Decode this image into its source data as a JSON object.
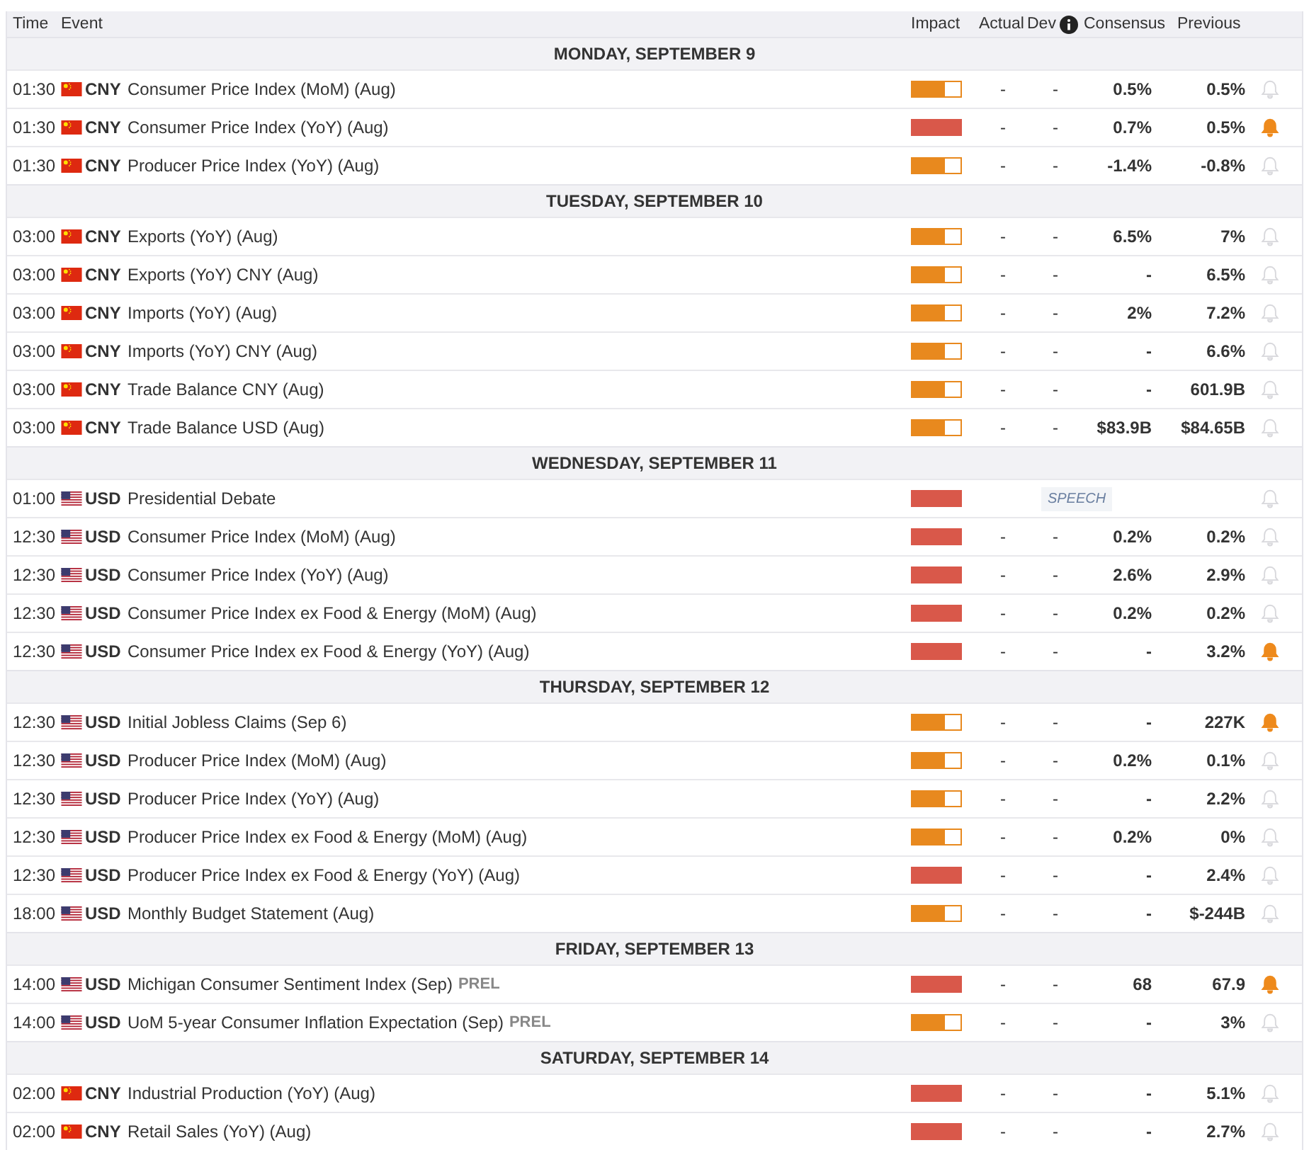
{
  "columns": [
    "Time",
    "Event",
    "Impact",
    "Actual",
    "Dev",
    "Consensus",
    "Previous"
  ],
  "days": [
    {
      "label": "MONDAY, SEPTEMBER 9",
      "events": [
        {
          "time": "01:30",
          "currency": "CNY",
          "event": "Consumer Price Index (MoM) (Aug)",
          "level": 0.66,
          "color": "#e8891e",
          "actual": "-",
          "dev": "-",
          "consensus": "0.5%",
          "previous": "0.5%",
          "alert": false
        },
        {
          "time": "01:30",
          "currency": "CNY",
          "event": "Consumer Price Index (YoY) (Aug)",
          "level": 1,
          "color": "#d9584a",
          "actual": "-",
          "dev": "-",
          "consensus": "0.7%",
          "previous": "0.5%",
          "alert": true
        },
        {
          "time": "01:30",
          "currency": "CNY",
          "event": "Producer Price Index (YoY) (Aug)",
          "level": 0.66,
          "color": "#e8891e",
          "actual": "-",
          "dev": "-",
          "consensus": "-1.4%",
          "previous": "-0.8%",
          "alert": false
        }
      ]
    },
    {
      "label": "TUESDAY, SEPTEMBER 10",
      "events": [
        {
          "time": "03:00",
          "currency": "CNY",
          "event": "Exports (YoY) (Aug)",
          "level": 0.66,
          "color": "#e8891e",
          "actual": "-",
          "dev": "-",
          "consensus": "6.5%",
          "previous": "7%",
          "alert": false
        },
        {
          "time": "03:00",
          "currency": "CNY",
          "event": "Exports (YoY) CNY (Aug)",
          "level": 0.66,
          "color": "#e8891e",
          "actual": "-",
          "dev": "-",
          "consensus": "-",
          "previous": "6.5%",
          "alert": false
        },
        {
          "time": "03:00",
          "currency": "CNY",
          "event": "Imports (YoY) (Aug)",
          "level": 0.66,
          "color": "#e8891e",
          "actual": "-",
          "dev": "-",
          "consensus": "2%",
          "previous": "7.2%",
          "alert": false
        },
        {
          "time": "03:00",
          "currency": "CNY",
          "event": "Imports (YoY) CNY (Aug)",
          "level": 0.66,
          "color": "#e8891e",
          "actual": "-",
          "dev": "-",
          "consensus": "-",
          "previous": "6.6%",
          "alert": false
        },
        {
          "time": "03:00",
          "currency": "CNY",
          "event": "Trade Balance CNY (Aug)",
          "level": 0.66,
          "color": "#e8891e",
          "actual": "-",
          "dev": "-",
          "consensus": "-",
          "previous": "601.9B",
          "alert": false
        },
        {
          "time": "03:00",
          "currency": "CNY",
          "event": "Trade Balance USD (Aug)",
          "level": 0.66,
          "color": "#e8891e",
          "actual": "-",
          "dev": "-",
          "consensus": "$83.9B",
          "previous": "$84.65B",
          "alert": false
        }
      ]
    },
    {
      "label": "WEDNESDAY, SEPTEMBER 11",
      "events": [
        {
          "time": "01:00",
          "currency": "USD",
          "event": "Presidential Debate",
          "level": 1,
          "color": "#d9584a",
          "tag": "SPEECH",
          "alert": false
        },
        {
          "time": "12:30",
          "currency": "USD",
          "event": "Consumer Price Index (MoM) (Aug)",
          "level": 1,
          "color": "#d9584a",
          "actual": "-",
          "dev": "-",
          "consensus": "0.2%",
          "previous": "0.2%",
          "alert": false
        },
        {
          "time": "12:30",
          "currency": "USD",
          "event": "Consumer Price Index (YoY) (Aug)",
          "level": 1,
          "color": "#d9584a",
          "actual": "-",
          "dev": "-",
          "consensus": "2.6%",
          "previous": "2.9%",
          "alert": false
        },
        {
          "time": "12:30",
          "currency": "USD",
          "event": "Consumer Price Index ex Food & Energy (MoM) (Aug)",
          "level": 1,
          "color": "#d9584a",
          "actual": "-",
          "dev": "-",
          "consensus": "0.2%",
          "previous": "0.2%",
          "alert": false
        },
        {
          "time": "12:30",
          "currency": "USD",
          "event": "Consumer Price Index ex Food & Energy (YoY) (Aug)",
          "level": 1,
          "color": "#d9584a",
          "actual": "-",
          "dev": "-",
          "consensus": "-",
          "previous": "3.2%",
          "alert": true
        }
      ]
    },
    {
      "label": "THURSDAY, SEPTEMBER 12",
      "events": [
        {
          "time": "12:30",
          "currency": "USD",
          "event": "Initial Jobless Claims (Sep 6)",
          "level": 0.66,
          "color": "#e8891e",
          "actual": "-",
          "dev": "-",
          "consensus": "-",
          "previous": "227K",
          "alert": true
        },
        {
          "time": "12:30",
          "currency": "USD",
          "event": "Producer Price Index (MoM) (Aug)",
          "level": 0.66,
          "color": "#e8891e",
          "actual": "-",
          "dev": "-",
          "consensus": "0.2%",
          "previous": "0.1%",
          "alert": false
        },
        {
          "time": "12:30",
          "currency": "USD",
          "event": "Producer Price Index (YoY) (Aug)",
          "level": 0.66,
          "color": "#e8891e",
          "actual": "-",
          "dev": "-",
          "consensus": "-",
          "previous": "2.2%",
          "alert": false
        },
        {
          "time": "12:30",
          "currency": "USD",
          "event": "Producer Price Index ex Food & Energy (MoM) (Aug)",
          "level": 0.66,
          "color": "#e8891e",
          "actual": "-",
          "dev": "-",
          "consensus": "0.2%",
          "previous": "0%",
          "alert": false
        },
        {
          "time": "12:30",
          "currency": "USD",
          "event": "Producer Price Index ex Food & Energy (YoY) (Aug)",
          "level": 1,
          "color": "#d9584a",
          "actual": "-",
          "dev": "-",
          "consensus": "-",
          "previous": "2.4%",
          "alert": false
        },
        {
          "time": "18:00",
          "currency": "USD",
          "event": "Monthly Budget Statement (Aug)",
          "level": 0.66,
          "color": "#e8891e",
          "actual": "-",
          "dev": "-",
          "consensus": "-",
          "previous": "$-244B",
          "alert": false
        }
      ]
    },
    {
      "label": "FRIDAY, SEPTEMBER 13",
      "events": [
        {
          "time": "14:00",
          "currency": "USD",
          "event": "Michigan Consumer Sentiment Index (Sep)",
          "suffix": "PREL",
          "level": 1,
          "color": "#d9584a",
          "actual": "-",
          "dev": "-",
          "consensus": "68",
          "previous": "67.9",
          "alert": true
        },
        {
          "time": "14:00",
          "currency": "USD",
          "event": "UoM 5-year Consumer Inflation Expectation (Sep)",
          "suffix": "PREL",
          "level": 0.66,
          "color": "#e8891e",
          "actual": "-",
          "dev": "-",
          "consensus": "-",
          "previous": "3%",
          "alert": false
        }
      ]
    },
    {
      "label": "SATURDAY, SEPTEMBER 14",
      "events": [
        {
          "time": "02:00",
          "currency": "CNY",
          "event": "Industrial Production (YoY) (Aug)",
          "level": 1,
          "color": "#d9584a",
          "actual": "-",
          "dev": "-",
          "consensus": "-",
          "previous": "5.1%",
          "alert": false
        },
        {
          "time": "02:00",
          "currency": "CNY",
          "event": "Retail Sales (YoY) (Aug)",
          "level": 1,
          "color": "#d9584a",
          "actual": "-",
          "dev": "-",
          "consensus": "-",
          "previous": "2.7%",
          "alert": false
        }
      ]
    }
  ]
}
